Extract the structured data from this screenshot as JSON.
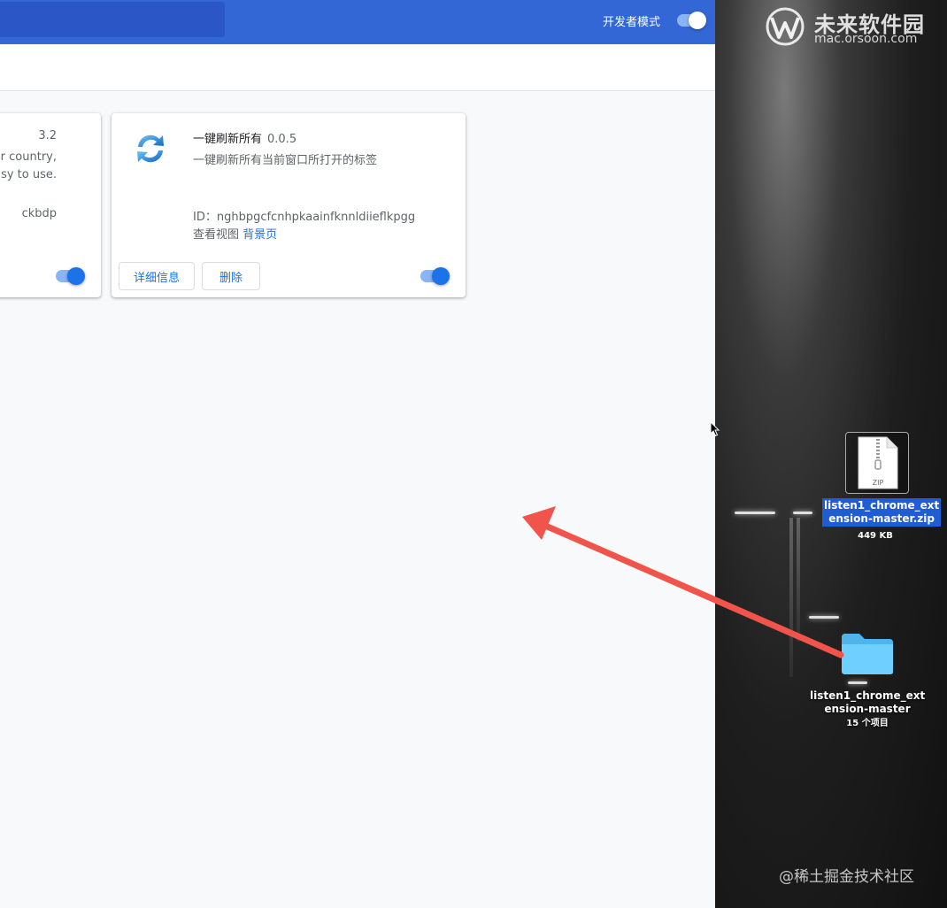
{
  "header": {
    "developer_mode_label": "开发者模式",
    "developer_mode_on": true
  },
  "cards": [
    {
      "version_fragment": "3.2",
      "desc_line1": "our country,",
      "desc_line2": "asy to use.",
      "id_fragment": "ckbdp",
      "enabled": true
    },
    {
      "name": "一键刷新所有",
      "version": "0.0.5",
      "description": "一键刷新所有当前窗口所打开的标签",
      "id_label": "ID：nghbpgcfcnhpkaainfknnldiieflkpgg",
      "views_prefix": "查看视图",
      "views_link": "背景页",
      "details_button": "详细信息",
      "remove_button": "删除",
      "enabled": true,
      "icon": "refresh-arrows-icon"
    }
  ],
  "desktop": {
    "zip_file": {
      "icon_text": "ZIP",
      "name_line1": "listen1_chrome_ext",
      "name_line2": "ension-master.zip",
      "size": "449 KB"
    },
    "folder": {
      "name_line1": "listen1_chrome_ext",
      "name_line2": "ension-master",
      "count": "15 个项目"
    }
  },
  "watermarks": {
    "brand_cn": "未来软件园",
    "brand_url": "mac.orsoon.com",
    "footer": "@稀土掘金技术社区"
  },
  "colors": {
    "header_blue": "#3367d6",
    "accent_blue": "#1a73e8",
    "toggle_track": "#8ab4f8",
    "arrow_red": "#f0544a",
    "selection_blue": "#1f5dd4",
    "folder_blue": "#5ac8fa"
  }
}
